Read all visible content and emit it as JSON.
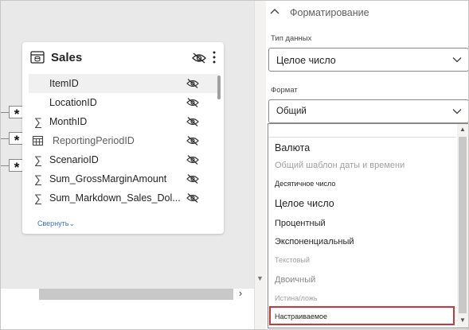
{
  "table_card": {
    "title": "Sales",
    "collapse_label": "Свернуть",
    "fields": [
      {
        "name": "ItemID",
        "icon": "none",
        "selected": true
      },
      {
        "name": "LocationID",
        "icon": "none"
      },
      {
        "name": "MonthID",
        "icon": "sigma-icon"
      },
      {
        "name": "ReportingPeriodID",
        "icon": "calendar-table-icon",
        "dim": true
      },
      {
        "name": "ScenarioID",
        "icon": "sigma-icon"
      },
      {
        "name": "Sum_GrossMarginAmount",
        "icon": "sigma-icon"
      },
      {
        "name": "Sum_Markdown_Sales_Dol...",
        "icon": "sigma-icon"
      }
    ]
  },
  "relationship_markers": [
    "*",
    "*",
    "*"
  ],
  "properties": {
    "section_title": "Форматирование",
    "data_type_label": "Тип данных",
    "data_type_value": "Целое число",
    "format_label": "Формат",
    "format_value": "Общий",
    "format_options": [
      "Валюта",
      "Общий шаблон даты и времени",
      "Десятичное число",
      "Целое число",
      "Процентный",
      "Экспоненциальный",
      "Текстовый",
      "Двоичный",
      "Истина/ложь",
      "Настраиваемое"
    ],
    "highlighted_option": "Настраиваемое"
  },
  "colors": {
    "highlight_border": "#d13438",
    "link": "#3a6fd8"
  }
}
